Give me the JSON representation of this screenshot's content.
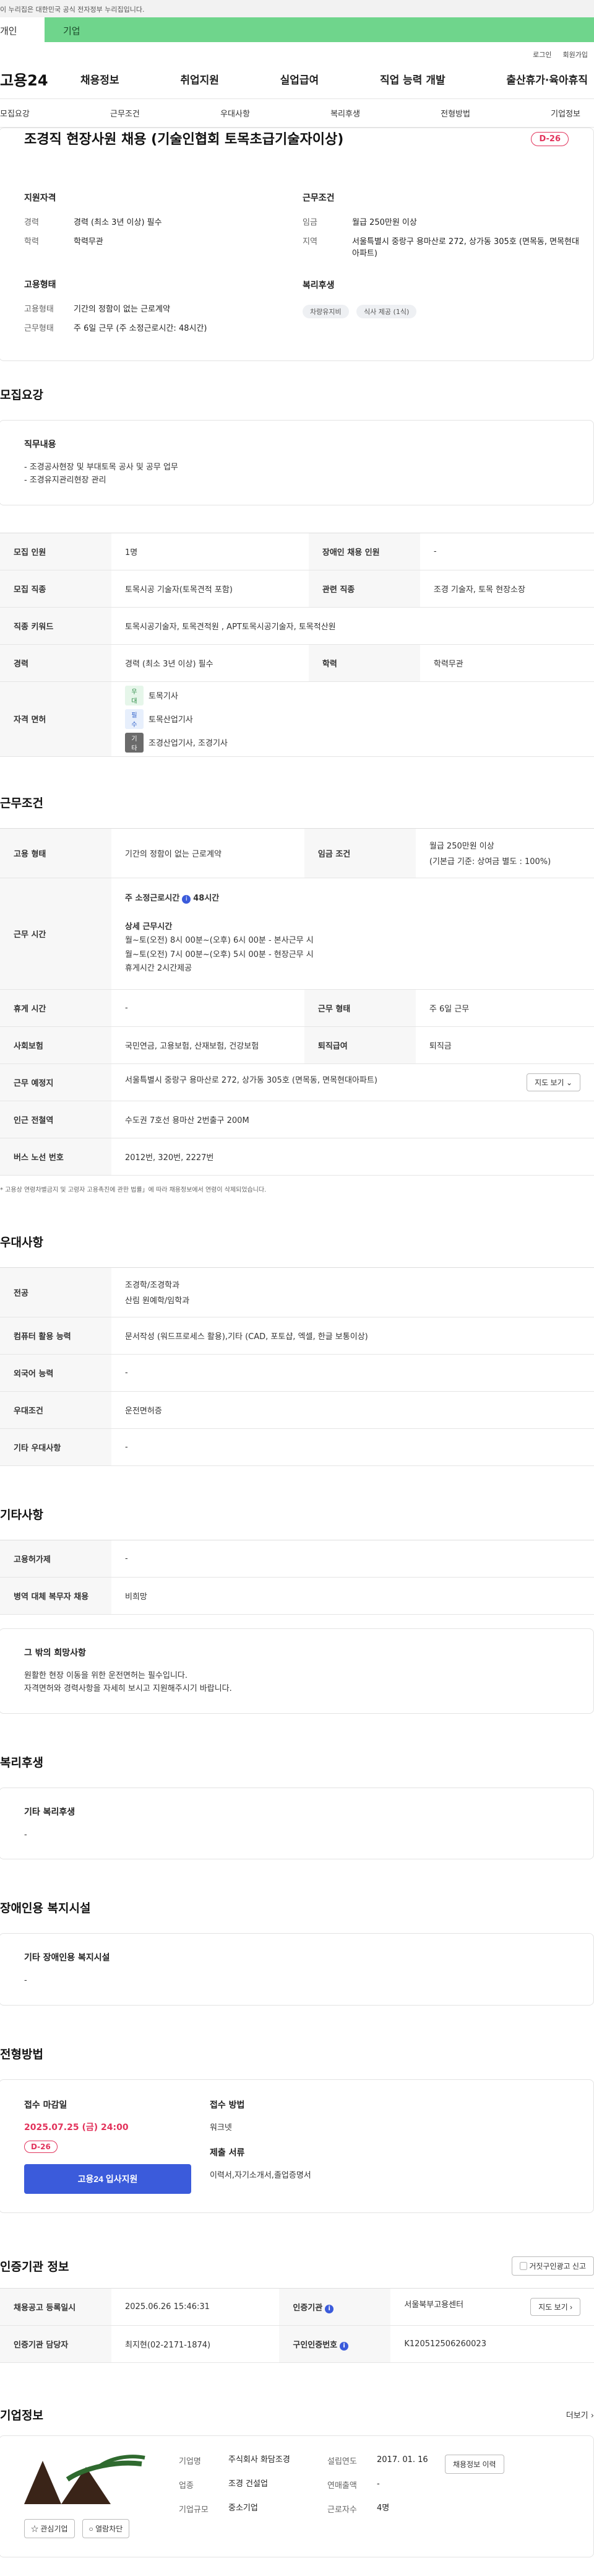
{
  "header": {
    "gov_banner": "이 누리집은 대한민국 공식 전자정부 누리집입니다.",
    "tab_individual": "개인",
    "tab_company": "기업",
    "login": "로그인",
    "signup": "회원가입",
    "logo": "고용24",
    "gnb": [
      "채용정보",
      "취업지원",
      "실업급여",
      "직업 능력 개발",
      "출산휴가·육아휴직"
    ],
    "subnav": [
      "모집요강",
      "근무조건",
      "우대사항",
      "복리후생",
      "전형방법",
      "기업정보"
    ]
  },
  "job": {
    "title": "조경직 현장사원 채용 (기술인협회 토목초급기술자이상)",
    "dday": "D-26",
    "qual_head": "지원자격",
    "cond_head": "근무조건",
    "emp_head": "고용형태",
    "welfare_head": "복리후생",
    "career_k": "경력",
    "career_v": "경력 (최소 3년 이상) 필수",
    "edu_k": "학력",
    "edu_v": "학력무관",
    "wage_k": "임금",
    "wage_v": "월급 250만원 이상",
    "region_k": "지역",
    "region_v": "서울특별시 중랑구 용마산로 272, 상가동 305호 (면목동, 면목현대아파트)",
    "emptype_k": "고용형태",
    "emptype_v": "기간의 정함이 없는 근로계약",
    "workform_k": "근무형태",
    "workform_v": "주 6일 근무 (주 소정근로시간: 48시간)",
    "welfare_chips": [
      "차량유지비",
      "식사 제공 (1식)"
    ]
  },
  "recruit": {
    "section_title": "모집요강",
    "duty_head": "직무내용",
    "duty_text": "- 조경공사현장 및 부대토목 공사 및 공무 업무\n- 조경유지관리현장 관리",
    "rows": {
      "count_k": "모집 인원",
      "count_v": "1명",
      "disabled_k": "장애인 채용 인원",
      "disabled_v": "-",
      "job_k": "모집 직종",
      "job_v": "토목시공 기술자(토목견적 포함)",
      "related_k": "관련 직종",
      "related_v": "조경 기술자, 토목 현장소장",
      "keyword_k": "직종 키워드",
      "keyword_v": "토목시공기술자, 토목견적원 , APT토목시공기술자, 토목적산원",
      "career_k": "경력",
      "career_v": "경력 (최소 3년 이상) 필수",
      "edu_k": "학력",
      "edu_v": "학력무관",
      "license_k": "자격 면허"
    },
    "licenses": [
      {
        "tag": "우대",
        "name": "토목기사"
      },
      {
        "tag": "필수",
        "name": "토목산업기사"
      },
      {
        "tag": "기타",
        "name": "조경산업기사, 조경기사"
      }
    ]
  },
  "conditions": {
    "section_title": "근무조건",
    "emptype_k": "고용 형태",
    "emptype_v": "기간의 정함이 없는 근로계약",
    "wage_k": "임금 조건",
    "wage_v1": "월급 250만원 이상",
    "wage_v2": "(기본급 기준: 상여금 별도 : 100%)",
    "worktime_k": "근무 시간",
    "weekly_label": "주 소정근로시간",
    "weekly_value": "48시간",
    "detail_head": "상세 근무시간",
    "detail_lines": [
      "월~토(오전) 8시 00분~(오후) 6시 00분 - 본사근무 시",
      "월~토(오전) 7시 00분~(오후) 5시 00분 - 현장근무 시",
      "휴게시간 2시간제공"
    ],
    "rest_k": "휴게 시간",
    "rest_v": "-",
    "workform_k": "근무 형태",
    "workform_v": "주 6일 근무",
    "insurance_k": "사회보험",
    "insurance_v": "국민연금, 고용보험, 산재보험, 건강보험",
    "retire_k": "퇴직급여",
    "retire_v": "퇴직금",
    "place_k": "근무 예정지",
    "place_v": "서울특별시 중랑구 용마산로 272, 상가동 305호 (면목동, 면목현대아파트)",
    "map_btn": "지도 보기",
    "subway_k": "인근 전철역",
    "subway_v": "수도권 7호선 용마산 2번출구 200M",
    "bus_k": "버스 노선 번호",
    "bus_v": "2012번, 320번, 2227번",
    "footnote": "* 고용상 연령차별금지 및 고령자 고용촉진에 관한 법률」에 따라 채용정보에서 연령이 삭제되었습니다."
  },
  "preference": {
    "section_title": "우대사항",
    "major_k": "전공",
    "major_v1": "조경학/조경학과",
    "major_v2": "산림 원예학/임학과",
    "pc_k": "컴퓨터 활용 능력",
    "pc_v": "문서작성 (워드프로세스 활용),기타 (CAD, 포토샵, 엑셀, 한글 보통이상)",
    "lang_k": "외국어 능력",
    "lang_v": "-",
    "cond_k": "우대조건",
    "cond_v": "운전면허증",
    "etc_k": "기타 우대사항",
    "etc_v": "-"
  },
  "others": {
    "section_title": "기타사항",
    "support_k": "고용허가제",
    "support_v": "-",
    "military_k": "병역 대체 복무자 채용",
    "military_v": "비희망",
    "hope_head": "그 밖의 희망사항",
    "hope_text": "원활한 현장 이동을 위한 운전면허는 필수입니다.\n자격면허와 경력사항을 자세히 보시고 지원해주시기 바랍니다."
  },
  "welfare": {
    "section_title": "복리후생",
    "head": "기타 복리후생",
    "text": "-"
  },
  "disabled_facility": {
    "section_title": "장애인용 복지시설",
    "head": "기타 장애인용 복지시설",
    "text": "-"
  },
  "apply": {
    "section_title": "전형방법",
    "deadline_k": "접수 마감일",
    "deadline_v": "2025.07.25 (금) 24:00",
    "dday": "D-26",
    "apply_btn": "고용24 입사지원",
    "method_k": "접수 방법",
    "method_v": "워크넷",
    "docs_k": "제출 서류",
    "docs_v": "이력서,자기소개서,졸업증명서"
  },
  "agency": {
    "section_title": "인증기관 정보",
    "report_btn": "거짓구인광고 신고",
    "reg_k": "채용공고 등록일시",
    "reg_v": "2025.06.26 15:46:31",
    "agency_k": "인증기관",
    "agency_v": "서울북부고용센터",
    "map_btn": "지도 보기",
    "manager_k": "인증기관 담당자",
    "manager_v": "최지현(02-2171-1874)",
    "num_k": "구인인증번호",
    "num_v": "K120512506260023"
  },
  "company": {
    "section_title": "기업정보",
    "more": "더보기",
    "interest_btn": "관심기업",
    "block_btn": "열람차단",
    "name_k": "기업명",
    "name_v": "주식회사 화담조경",
    "industry_k": "업종",
    "industry_v": "조경 건설업",
    "size_k": "기업규모",
    "size_v": "중소기업",
    "founded_k": "설립연도",
    "founded_v": "2017. 01. 16",
    "sales_k": "연매출액",
    "sales_v": "-",
    "staff_k": "근로자수",
    "staff_v": "4명",
    "history_btn": "채용정보 이력"
  }
}
